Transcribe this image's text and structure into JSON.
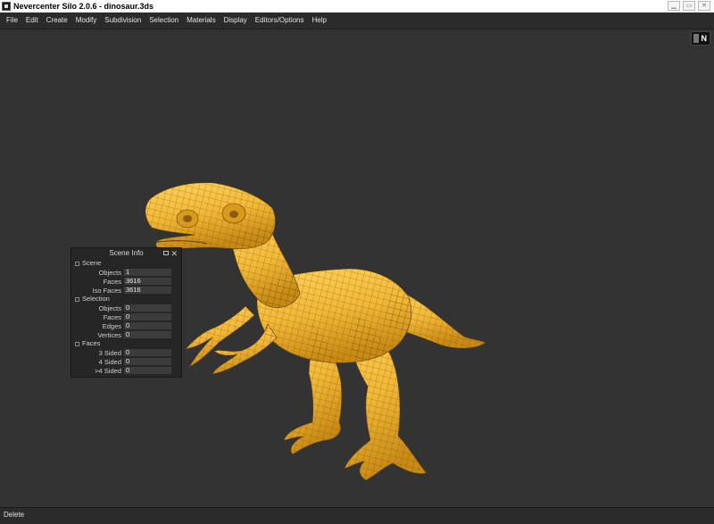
{
  "window": {
    "title": "Nevercenter Silo 2.0.6 - dinosaur.3ds",
    "controls": {
      "minimize": "▁",
      "maximize": "▭",
      "close": "✕"
    }
  },
  "menu": {
    "items": [
      "File",
      "Edit",
      "Create",
      "Modify",
      "Subdivision",
      "Selection",
      "Materials",
      "Display",
      "Editors/Options",
      "Help"
    ]
  },
  "viewport": {
    "orientation_label": "N",
    "model_color": "#f2b736",
    "background_color": "#333333"
  },
  "scene_info": {
    "title": "Scene Info",
    "sections": {
      "scene": {
        "label": "Scene",
        "rows": [
          {
            "label": "Objects",
            "value": "1"
          },
          {
            "label": "Faces",
            "value": "3616"
          },
          {
            "label": "Iso Faces",
            "value": "3616"
          }
        ]
      },
      "selection": {
        "label": "Selection",
        "rows": [
          {
            "label": "Objects",
            "value": "0"
          },
          {
            "label": "Faces",
            "value": "0"
          },
          {
            "label": "Edges",
            "value": "0"
          },
          {
            "label": "Vertices",
            "value": "0"
          }
        ]
      },
      "faces": {
        "label": "Faces",
        "rows": [
          {
            "label": "3 Sided",
            "value": "0"
          },
          {
            "label": "4 Sided",
            "value": "0"
          },
          {
            "label": ">4 Sided",
            "value": "0"
          }
        ]
      }
    }
  },
  "status": {
    "text": "Delete"
  }
}
